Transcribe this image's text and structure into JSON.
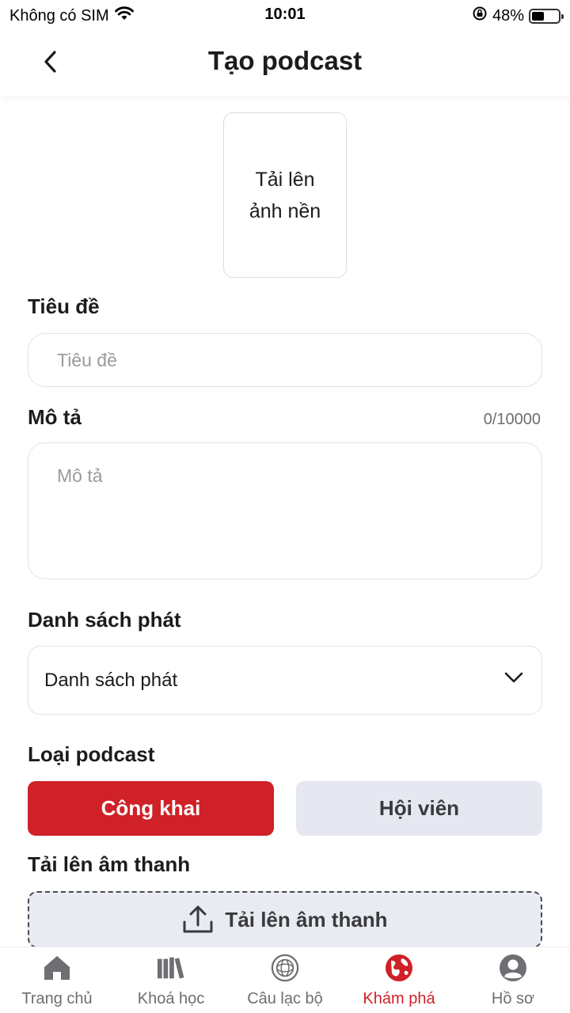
{
  "status_bar": {
    "carrier": "Không có SIM",
    "time": "10:01",
    "battery": "48%",
    "battery_level": 0.48
  },
  "header": {
    "title": "Tạo podcast",
    "back_icon": "chevron-left-icon"
  },
  "cover": {
    "label": "Tải lên ảnh nền"
  },
  "form": {
    "title_label": "Tiêu đề",
    "title_placeholder": "Tiêu đề",
    "title_value": "",
    "description_label": "Mô tả",
    "description_placeholder": "Mô tả",
    "description_value": "",
    "description_counter": "0/10000",
    "playlist_label": "Danh sách phát",
    "playlist_value": "Danh sách phát",
    "type_label": "Loại podcast",
    "type_options": [
      "Công khai",
      "Hội viên"
    ],
    "type_selected": "Công khai",
    "audio_label": "Tải lên âm thanh",
    "audio_button": "Tải lên âm thanh"
  },
  "tab_bar": {
    "items": [
      {
        "label": "Trang chủ",
        "icon": "home-icon"
      },
      {
        "label": "Khoá học",
        "icon": "books-icon"
      },
      {
        "label": "Câu lạc bộ",
        "icon": "club-icon"
      },
      {
        "label": "Khám phá",
        "icon": "globe-icon"
      },
      {
        "label": "Hồ sơ",
        "icon": "profile-icon"
      }
    ],
    "active": "Khám phá"
  },
  "colors": {
    "accent": "#cf2127",
    "secondary_button": "#e5e8f0",
    "text": "#1c1c1e",
    "muted": "#6e6e73"
  }
}
